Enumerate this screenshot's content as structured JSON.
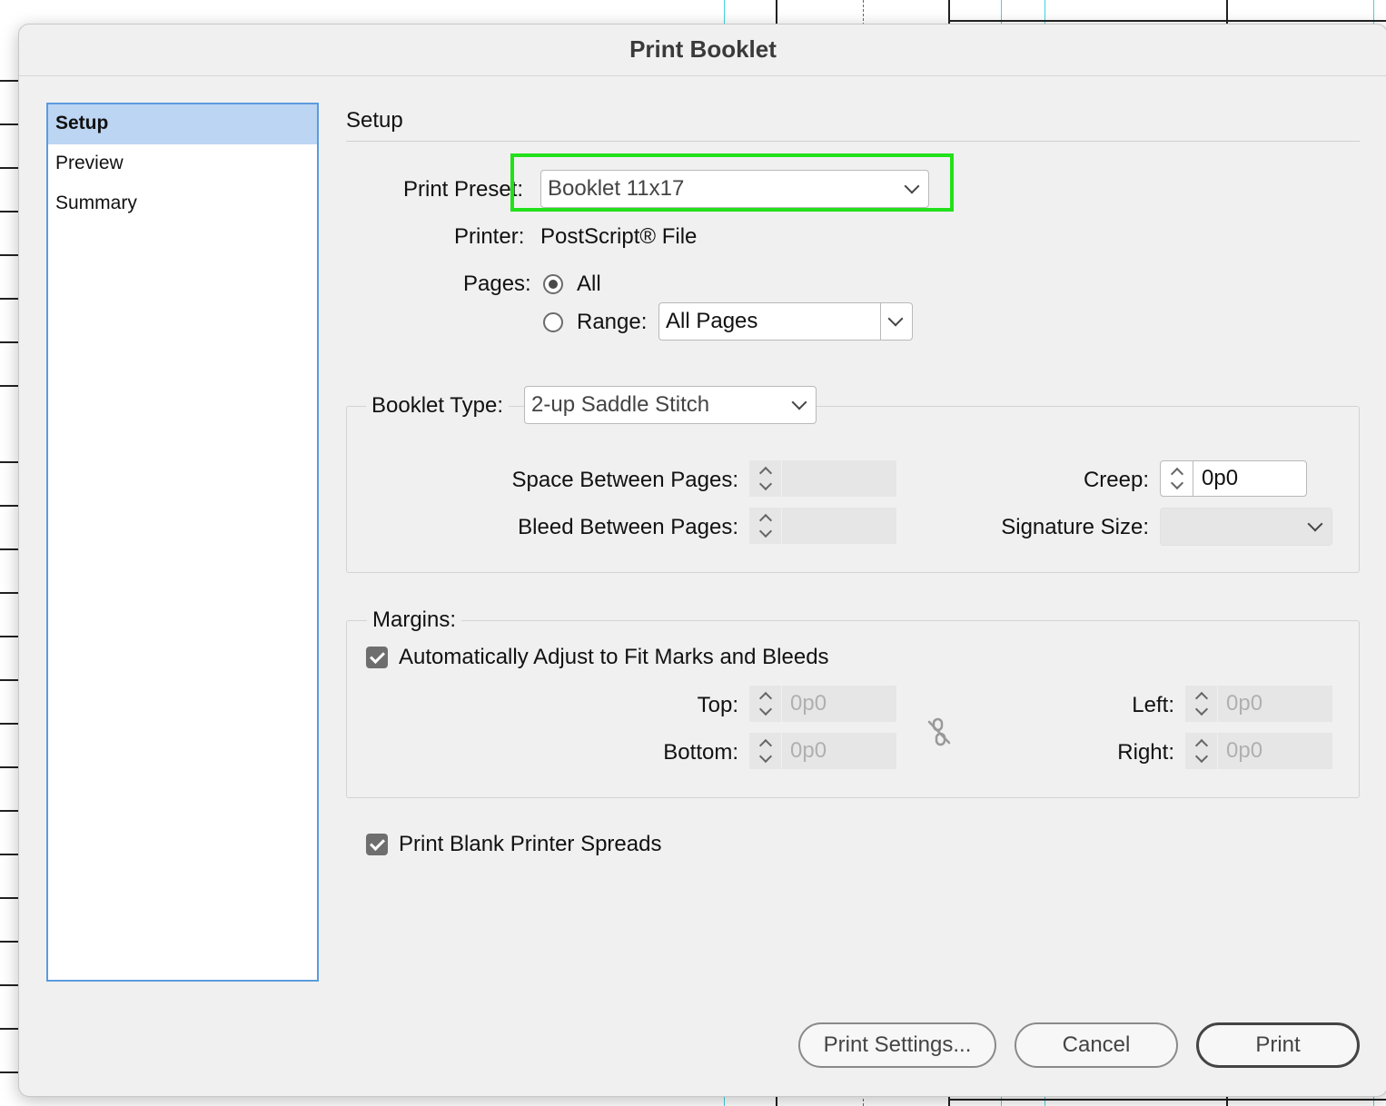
{
  "dialog": {
    "title": "Print Booklet"
  },
  "sidebar": {
    "items": [
      {
        "label": "Setup",
        "selected": true
      },
      {
        "label": "Preview",
        "selected": false
      },
      {
        "label": "Summary",
        "selected": false
      }
    ]
  },
  "setup": {
    "heading": "Setup",
    "print_preset": {
      "label": "Print Preset:",
      "value": "Booklet 11x17"
    },
    "printer": {
      "label": "Printer:",
      "value": "PostScript® File"
    },
    "pages": {
      "label": "Pages:",
      "all_label": "All",
      "range_label": "Range:",
      "range_value": "All Pages",
      "selected": "All"
    },
    "booklet_type": {
      "label": "Booklet Type:",
      "value": "2-up Saddle Stitch"
    },
    "space_between_pages": {
      "label": "Space Between Pages:",
      "value": ""
    },
    "bleed_between_pages": {
      "label": "Bleed Between Pages:",
      "value": ""
    },
    "creep": {
      "label": "Creep:",
      "value": "0p0"
    },
    "signature_size": {
      "label": "Signature Size:",
      "value": ""
    },
    "margins": {
      "label": "Margins:",
      "auto_adjust": {
        "label": "Automatically Adjust to Fit Marks and Bleeds",
        "checked": true
      },
      "top": {
        "label": "Top:",
        "value": "0p0"
      },
      "bottom": {
        "label": "Bottom:",
        "value": "0p0"
      },
      "left": {
        "label": "Left:",
        "value": "0p0"
      },
      "right": {
        "label": "Right:",
        "value": "0p0"
      }
    },
    "print_blank_spreads": {
      "label": "Print Blank Printer Spreads",
      "checked": true
    }
  },
  "buttons": {
    "print_settings": "Print Settings...",
    "cancel": "Cancel",
    "print": "Print"
  },
  "colors": {
    "highlight": "#22e01a",
    "selection": "#bcd5f3",
    "sidebar_border": "#5b9bde"
  }
}
